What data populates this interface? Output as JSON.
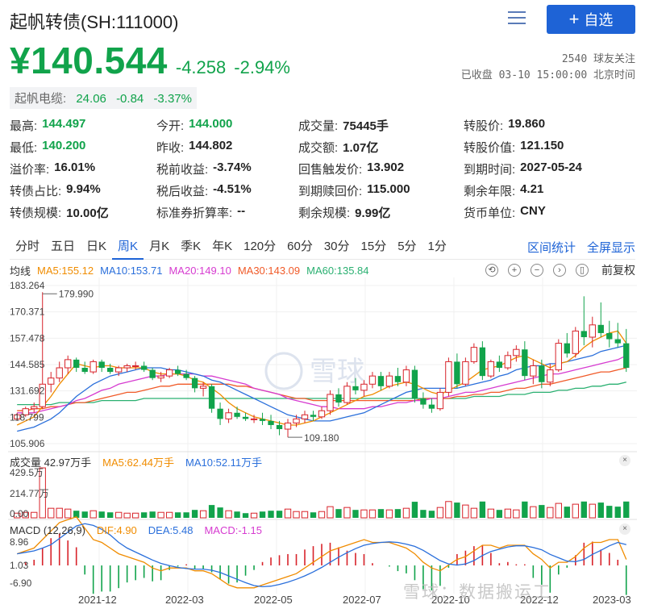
{
  "header": {
    "title": "起帆转债(SH:111000)",
    "follow_label": "自选",
    "price": "¥140.544",
    "change": "-4.258",
    "change_pct": "-2.94%",
    "followers": "2540 球友关注",
    "status": "已收盘 03-10 15:00:00 北京时间"
  },
  "stock": {
    "name": "起帆电缆:",
    "price": "24.06",
    "change": "-0.84",
    "change_pct": "-3.37%"
  },
  "stats": [
    [
      {
        "k": "最高:",
        "v": "144.497",
        "cls": "green"
      },
      {
        "k": "今开:",
        "v": "144.000",
        "cls": "green"
      },
      {
        "k": "成交量:",
        "v": "75445手",
        "cls": ""
      },
      {
        "k": "转股价:",
        "v": "19.860",
        "cls": ""
      }
    ],
    [
      {
        "k": "最低:",
        "v": "140.200",
        "cls": "green"
      },
      {
        "k": "昨收:",
        "v": "144.802",
        "cls": ""
      },
      {
        "k": "成交额:",
        "v": "1.07亿",
        "cls": ""
      },
      {
        "k": "转股价值:",
        "v": "121.150",
        "cls": ""
      }
    ],
    [
      {
        "k": "溢价率:",
        "v": "16.01%",
        "cls": ""
      },
      {
        "k": "税前收益:",
        "v": "-3.74%",
        "cls": ""
      },
      {
        "k": "回售触发价:",
        "v": "13.902",
        "cls": ""
      },
      {
        "k": "到期时间:",
        "v": "2027-05-24",
        "cls": ""
      }
    ],
    [
      {
        "k": "转债占比:",
        "v": "9.94%",
        "cls": ""
      },
      {
        "k": "税后收益:",
        "v": "-4.51%",
        "cls": ""
      },
      {
        "k": "到期赎回价:",
        "v": "115.000",
        "cls": ""
      },
      {
        "k": "剩余年限:",
        "v": "4.21",
        "cls": ""
      }
    ],
    [
      {
        "k": "转债规模:",
        "v": "10.00亿",
        "cls": ""
      },
      {
        "k": "标准券折算率:",
        "v": "--",
        "cls": ""
      },
      {
        "k": "剩余规模:",
        "v": "9.99亿",
        "cls": ""
      },
      {
        "k": "货币单位:",
        "v": "CNY",
        "cls": ""
      }
    ]
  ],
  "tabs": [
    "分时",
    "五日",
    "日K",
    "周K",
    "月K",
    "季K",
    "年K",
    "120分",
    "60分",
    "30分",
    "15分",
    "5分",
    "1分"
  ],
  "active_tab": "周K",
  "tab_links": [
    "区间统计",
    "全屏显示"
  ],
  "ma": {
    "label": "均线",
    "items": [
      {
        "text": "MA5:155.12",
        "color": "#f08c00"
      },
      {
        "text": "MA10:153.71",
        "color": "#2a6fdb"
      },
      {
        "text": "MA20:149.10",
        "color": "#d63bd0"
      },
      {
        "text": "MA30:143.09",
        "color": "#f05a28"
      },
      {
        "text": "MA60:135.84",
        "color": "#2ab071"
      }
    ],
    "restore_label": "前复权"
  },
  "volume": {
    "label": "成交量 42.97万手",
    "ma5": "MA5:62.44万手",
    "ma10": "MA10:52.11万手",
    "y_labels": [
      "429.5万",
      "214.77万",
      "0.00"
    ]
  },
  "macd": {
    "label": "MACD (12,26,9)",
    "dif": "DIF:4.90",
    "dea": "DEA:5.48",
    "macd": "MACD:-1.15",
    "y_labels": [
      "8.96",
      "1.03",
      "-6.90"
    ]
  },
  "price_axis": [
    "183.264",
    "170.371",
    "157.478",
    "144.585",
    "131.692",
    "118.799",
    "105.906"
  ],
  "annotations": {
    "high": "179.990",
    "low": "109.180"
  },
  "x_labels": [
    "2021-12",
    "2022-03",
    "2022-05",
    "2022-07",
    "2022-10",
    "2022-12",
    "2023-03"
  ],
  "watermark": {
    "xq": "雪球：数据搬运工",
    "wx": "数据搬运工"
  },
  "colors": {
    "up": "#d8232a",
    "down": "#11a34b",
    "accent": "#1e63d6"
  },
  "chart_data": {
    "type": "candlestick",
    "ylim": [
      105.906,
      183.264
    ],
    "ohlc": [
      [
        118,
        121,
        117,
        120
      ],
      [
        120,
        124,
        119,
        123
      ],
      [
        123,
        126,
        121,
        124
      ],
      [
        124,
        180,
        123,
        135
      ],
      [
        135,
        141,
        131,
        138
      ],
      [
        138,
        146,
        136,
        143
      ],
      [
        143,
        149,
        140,
        147
      ],
      [
        147,
        148,
        141,
        143
      ],
      [
        143,
        146,
        140,
        141
      ],
      [
        141,
        147,
        140,
        146
      ],
      [
        146,
        147,
        141,
        143
      ],
      [
        143,
        145,
        140,
        141
      ],
      [
        141,
        144,
        139,
        143
      ],
      [
        143,
        145,
        141,
        144
      ],
      [
        144,
        146,
        142,
        144
      ],
      [
        144,
        146,
        141,
        142
      ],
      [
        142,
        143,
        137,
        138
      ],
      [
        138,
        141,
        136,
        139
      ],
      [
        139,
        143,
        138,
        142
      ],
      [
        142,
        144,
        139,
        140
      ],
      [
        140,
        142,
        137,
        138
      ],
      [
        138,
        139,
        131,
        133
      ],
      [
        133,
        136,
        129,
        134
      ],
      [
        134,
        135,
        121,
        123
      ],
      [
        123,
        126,
        115,
        118
      ],
      [
        118,
        123,
        116,
        121
      ],
      [
        121,
        124,
        118,
        119
      ],
      [
        119,
        121,
        117,
        118
      ],
      [
        118,
        120,
        116,
        118
      ],
      [
        118,
        121,
        115,
        117
      ],
      [
        117,
        120,
        113,
        115
      ],
      [
        115,
        117,
        110,
        113
      ],
      [
        113,
        118,
        109,
        116
      ],
      [
        116,
        120,
        114,
        118
      ],
      [
        118,
        122,
        116,
        120
      ],
      [
        120,
        122,
        117,
        119
      ],
      [
        119,
        124,
        118,
        122
      ],
      [
        122,
        132,
        120,
        130
      ],
      [
        130,
        133,
        124,
        126
      ],
      [
        126,
        136,
        125,
        134
      ],
      [
        134,
        138,
        130,
        132
      ],
      [
        132,
        137,
        129,
        135
      ],
      [
        135,
        141,
        133,
        139
      ],
      [
        139,
        141,
        132,
        134
      ],
      [
        134,
        141,
        133,
        139
      ],
      [
        139,
        143,
        134,
        136
      ],
      [
        136,
        144,
        134,
        142
      ],
      [
        142,
        144,
        126,
        128
      ],
      [
        128,
        131,
        123,
        125
      ],
      [
        125,
        128,
        121,
        123
      ],
      [
        123,
        133,
        122,
        131
      ],
      [
        131,
        148,
        129,
        146
      ],
      [
        146,
        150,
        133,
        135
      ],
      [
        135,
        148,
        134,
        146
      ],
      [
        146,
        155,
        145,
        153
      ],
      [
        153,
        156,
        137,
        139
      ],
      [
        139,
        147,
        138,
        146
      ],
      [
        146,
        149,
        141,
        143
      ],
      [
        143,
        151,
        142,
        149
      ],
      [
        149,
        154,
        146,
        152
      ],
      [
        152,
        156,
        137,
        139
      ],
      [
        139,
        147,
        135,
        144
      ],
      [
        144,
        147,
        133,
        136
      ],
      [
        136,
        145,
        134,
        142
      ],
      [
        142,
        157,
        141,
        155
      ],
      [
        155,
        160,
        148,
        150
      ],
      [
        150,
        163,
        148,
        161
      ],
      [
        161,
        178,
        154,
        158
      ],
      [
        158,
        168,
        153,
        164
      ],
      [
        164,
        175,
        158,
        160
      ],
      [
        160,
        166,
        153,
        157
      ],
      [
        157,
        165,
        153,
        155
      ],
      [
        155,
        162,
        141,
        143
      ]
    ],
    "ma5": [
      115,
      117,
      119,
      124,
      129,
      135,
      140,
      145,
      144,
      143,
      144,
      144,
      143,
      143,
      143,
      143,
      141,
      140,
      140,
      140,
      139,
      137,
      136,
      133,
      130,
      126,
      123,
      121,
      119,
      118,
      117,
      116,
      115,
      115,
      116,
      117,
      119,
      121,
      123,
      125,
      127,
      129,
      130,
      132,
      134,
      135,
      136,
      135,
      133,
      131,
      130,
      132,
      134,
      136,
      139,
      142,
      143,
      144,
      146,
      148,
      149,
      147,
      145,
      143,
      145,
      146,
      149,
      153,
      156,
      158,
      160,
      161,
      155
    ],
    "ma10": [
      112,
      113,
      114,
      116,
      118,
      121,
      125,
      129,
      132,
      135,
      137,
      139,
      140,
      141,
      142,
      143,
      143,
      143,
      142,
      142,
      141,
      140,
      139,
      137,
      136,
      134,
      132,
      130,
      128,
      126,
      124,
      122,
      120,
      119,
      118,
      117,
      117,
      117,
      118,
      119,
      120,
      121,
      123,
      125,
      127,
      129,
      131,
      132,
      133,
      133,
      133,
      133,
      133,
      134,
      135,
      136,
      137,
      139,
      140,
      142,
      143,
      144,
      144,
      145,
      145,
      146,
      147,
      148,
      149,
      151,
      152,
      153,
      154
    ],
    "ma20": [
      121,
      121,
      121,
      122,
      123,
      124,
      125,
      127,
      128,
      130,
      132,
      133,
      135,
      136,
      137,
      138,
      139,
      139,
      140,
      140,
      140,
      140,
      139,
      139,
      138,
      137,
      136,
      135,
      133,
      132,
      131,
      130,
      128,
      127,
      126,
      125,
      124,
      124,
      123,
      123,
      123,
      123,
      124,
      124,
      125,
      126,
      126,
      127,
      127,
      128,
      128,
      129,
      130,
      131,
      131,
      132,
      133,
      134,
      135,
      136,
      137,
      138,
      139,
      140,
      140,
      141,
      142,
      143,
      144,
      145,
      146,
      147,
      149
    ],
    "ma30": [
      122,
      122,
      123,
      123,
      124,
      124,
      125,
      126,
      126,
      127,
      128,
      129,
      130,
      131,
      131,
      132,
      133,
      134,
      134,
      135,
      135,
      135,
      135,
      135,
      135,
      135,
      134,
      134,
      133,
      132,
      131,
      130,
      129,
      128,
      128,
      127,
      127,
      127,
      127,
      127,
      127,
      127,
      127,
      127,
      127,
      127,
      127,
      127,
      128,
      128,
      128,
      128,
      129,
      129,
      130,
      130,
      131,
      131,
      132,
      133,
      133,
      134,
      135,
      135,
      136,
      137,
      138,
      139,
      140,
      141,
      141,
      142,
      143
    ],
    "ma60": [
      125,
      125,
      125,
      125,
      125,
      126,
      126,
      126,
      126,
      126,
      127,
      127,
      127,
      127,
      127,
      128,
      128,
      128,
      128,
      128,
      128,
      128,
      128,
      128,
      128,
      128,
      128,
      128,
      128,
      128,
      128,
      128,
      128,
      128,
      128,
      128,
      128,
      128,
      128,
      128,
      128,
      128,
      128,
      128,
      128,
      128,
      128,
      128,
      128,
      128,
      128,
      128,
      128,
      128,
      129,
      129,
      129,
      129,
      130,
      130,
      130,
      131,
      131,
      131,
      132,
      132,
      133,
      133,
      134,
      134,
      135,
      135,
      136
    ]
  }
}
